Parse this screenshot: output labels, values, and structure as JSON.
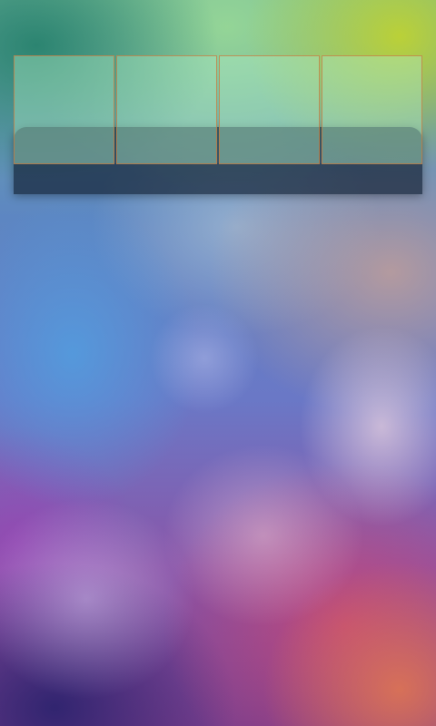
{
  "screen": {
    "type": "home-screen",
    "wallpaper": "blurred-bokeh"
  },
  "widget_panel": {
    "visible": true
  },
  "tiles": [
    {
      "label": ""
    },
    {
      "label": ""
    },
    {
      "label": ""
    },
    {
      "label": ""
    }
  ],
  "colors": {
    "tile_border": "#c8783c",
    "tile_fill": "#afebc3",
    "panel_fill": "#142337"
  }
}
